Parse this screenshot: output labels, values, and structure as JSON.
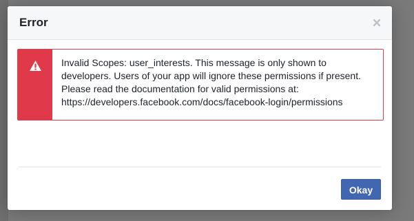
{
  "dialog": {
    "title": "Error",
    "close_icon": "close-icon",
    "alert": {
      "icon": "warning-icon",
      "accent_color": "#e0394a",
      "message": "Invalid Scopes: user_interests. This message is only shown to developers. Users of your app will ignore these permissions if present. Please read the documentation for valid permissions at: https://developers.facebook.com/docs/facebook-login/permissions"
    },
    "footer": {
      "okay_label": "Okay",
      "button_color": "#4267b2"
    }
  }
}
